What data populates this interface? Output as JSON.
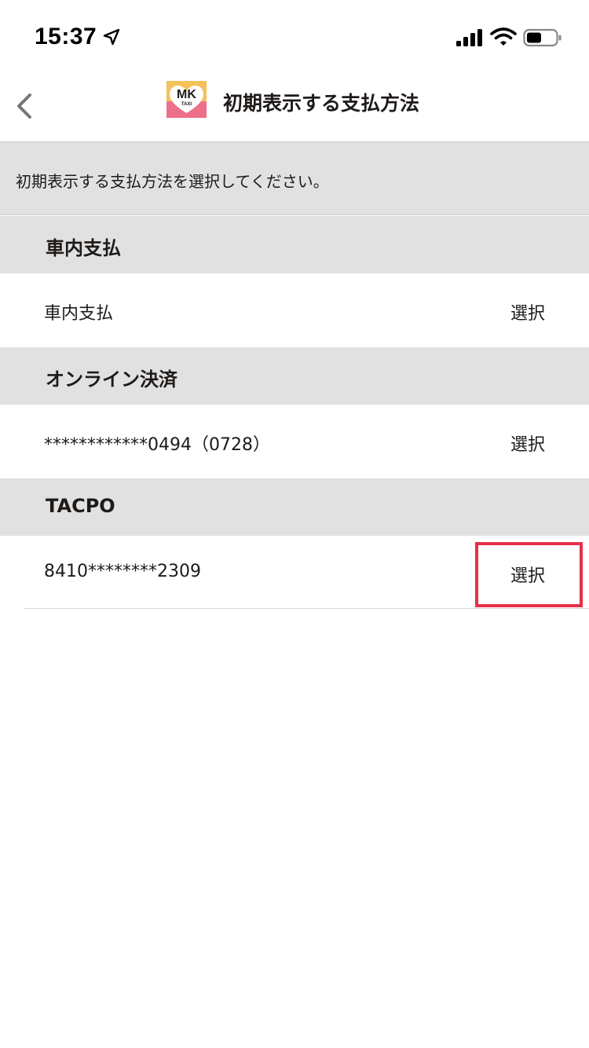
{
  "status_bar": {
    "time": "15:37",
    "location_icon": "location-arrow-icon",
    "signal_icon": "cellular-signal-icon",
    "wifi_icon": "wifi-icon",
    "battery_icon": "battery-icon"
  },
  "nav": {
    "back_icon": "chevron-left-icon",
    "logo_text": "MK",
    "logo_subtext": "TAXI",
    "title": "初期表示する支払方法"
  },
  "instruction": "初期表示する支払方法を選択してください。",
  "sections": [
    {
      "header": "車内支払",
      "item": {
        "label": "車内支払",
        "action": "選択"
      }
    },
    {
      "header": "オンライン決済",
      "item": {
        "label": "************0494（0728）",
        "action": "選択"
      }
    },
    {
      "header": "TACPO",
      "item": {
        "label": "8410********2309",
        "action": "選択"
      }
    }
  ],
  "colors": {
    "highlight": "#e8304a",
    "section_bg": "#e1e1e1",
    "logo_yellow": "#f5c15a",
    "logo_pink": "#ee6f8a"
  }
}
